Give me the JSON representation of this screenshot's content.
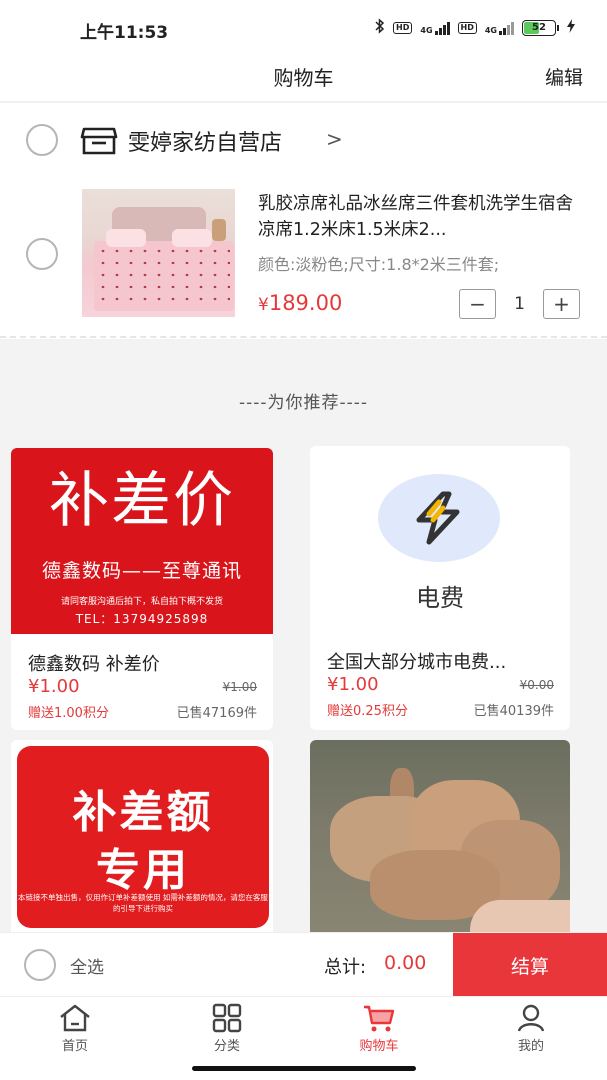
{
  "status_bar": {
    "time": "上午11:53",
    "battery": "52",
    "net1": "4G",
    "net2": "4G",
    "hd": "HD"
  },
  "nav": {
    "title": "购物车",
    "edit": "编辑"
  },
  "store": {
    "name": "雯婷家纺自营店",
    "chevron": ">"
  },
  "cart_item": {
    "title": "乳胶凉席礼品冰丝席三件套机洗学生宿舍凉席1.2米床1.5米床2...",
    "spec": "颜色:淡粉色;尺寸:1.8*2米三件套;",
    "price_symbol": "¥",
    "price": "189.00",
    "minus": "−",
    "plus": "+",
    "quantity": "1"
  },
  "recommend": {
    "header": "----为你推荐----"
  },
  "products": [
    {
      "banner_big": "补差价",
      "banner_mid": "德鑫数码——至尊通讯",
      "banner_small": "请同客服沟通后拍下，私自拍下概不发货",
      "banner_tel": "TEL：13794925898",
      "title": "德鑫数码 补差价",
      "price": "¥1.00",
      "old_price": "¥1.00",
      "bonus": "赠送1.00积分",
      "sold": "已售47169件"
    },
    {
      "banner_text": "电费",
      "title": "全国大部分城市电费...",
      "price": "¥1.00",
      "old_price": "¥0.00",
      "bonus": "赠送0.25积分",
      "sold": "已售40139件"
    },
    {
      "banner_t1": "补差额",
      "banner_t2": "专用",
      "banner_t3": "本链接不单独出售，仅用作订单补差额使用 如需补差额的情况，请您在客服的引导下进行购买"
    },
    {}
  ],
  "checkout": {
    "select_all": "全选",
    "total_label": "总计:",
    "total_value": "0.00",
    "button": "结算"
  },
  "tabs": [
    {
      "label": "首页",
      "icon": "home-icon"
    },
    {
      "label": "分类",
      "icon": "grid-icon"
    },
    {
      "label": "购物车",
      "icon": "cart-icon",
      "active": true
    },
    {
      "label": "我的",
      "icon": "user-icon"
    }
  ],
  "colors": {
    "accent": "#e8363b",
    "price": "#e43a3a",
    "banner_red": "#d9151b"
  }
}
